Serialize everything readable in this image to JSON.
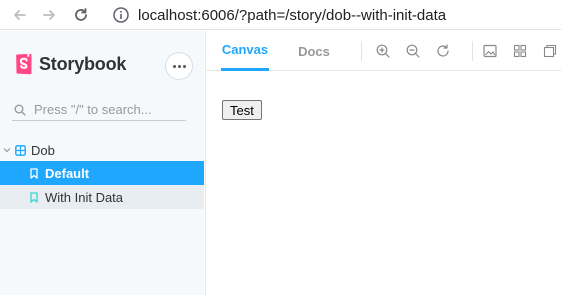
{
  "browser": {
    "url": "localhost:6006/?path=/story/dob--with-init-data",
    "back_icon": "arrow-left-icon",
    "forward_icon": "arrow-right-icon",
    "reload_icon": "reload-icon",
    "info_icon": "info-icon"
  },
  "sidebar": {
    "brand": "Storybook",
    "search_placeholder": "Press \"/\" to search...",
    "tree": {
      "group_label": "Dob",
      "items": [
        {
          "label": "Default",
          "state": "selected"
        },
        {
          "label": "With Init Data",
          "state": "hovered"
        }
      ]
    }
  },
  "toolbar": {
    "tabs": [
      {
        "label": "Canvas",
        "active": true
      },
      {
        "label": "Docs",
        "active": false
      }
    ],
    "icons": [
      "zoom-in-icon",
      "zoom-out-icon",
      "zoom-reset-icon",
      "image-icon",
      "grid-icon",
      "viewport-icon"
    ]
  },
  "canvas": {
    "button_label": "Test"
  },
  "colors": {
    "accent": "#1ea7fd",
    "brand": "#ff4785",
    "sidebar_bg": "#f6f9fc"
  }
}
